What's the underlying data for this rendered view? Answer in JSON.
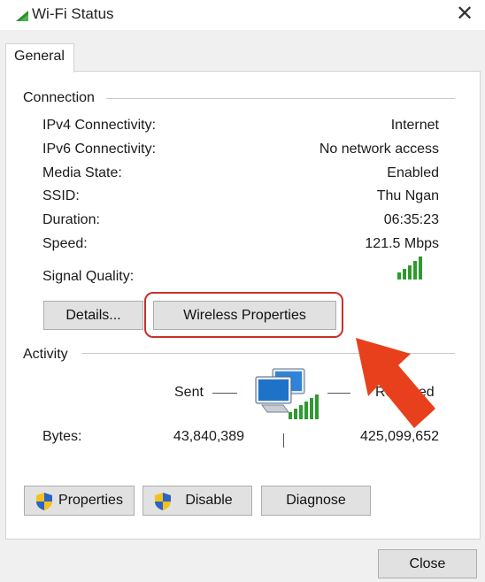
{
  "window": {
    "title": "Wi-Fi Status",
    "close_glyph": "✕"
  },
  "tabs": [
    {
      "label": "General"
    }
  ],
  "connection": {
    "heading": "Connection",
    "rows": [
      {
        "label": "IPv4 Connectivity:",
        "value": "Internet"
      },
      {
        "label": "IPv6 Connectivity:",
        "value": "No network access"
      },
      {
        "label": "Media State:",
        "value": "Enabled"
      },
      {
        "label": "SSID:",
        "value": "Thu Ngan"
      },
      {
        "label": "Duration:",
        "value": "06:35:23"
      },
      {
        "label": "Speed:",
        "value": "121.5 Mbps"
      }
    ],
    "signal_label": "Signal Quality:",
    "signal_icon": "signal-bars-icon",
    "details_button": "Details...",
    "wireless_button": "Wireless Properties"
  },
  "activity": {
    "heading": "Activity",
    "sent_label": "Sent",
    "received_label": "Received",
    "bytes_label": "Bytes:",
    "bytes_sent": "43,840,389",
    "bytes_received": "425,099,652",
    "network_icon": "network-computers-icon"
  },
  "buttons": {
    "properties": "Properties",
    "disable": "Disable",
    "diagnose": "Diagnose",
    "close": "Close"
  },
  "annotation": {
    "highlight_color": "#c9302c",
    "arrow_color": "#e8401c"
  }
}
